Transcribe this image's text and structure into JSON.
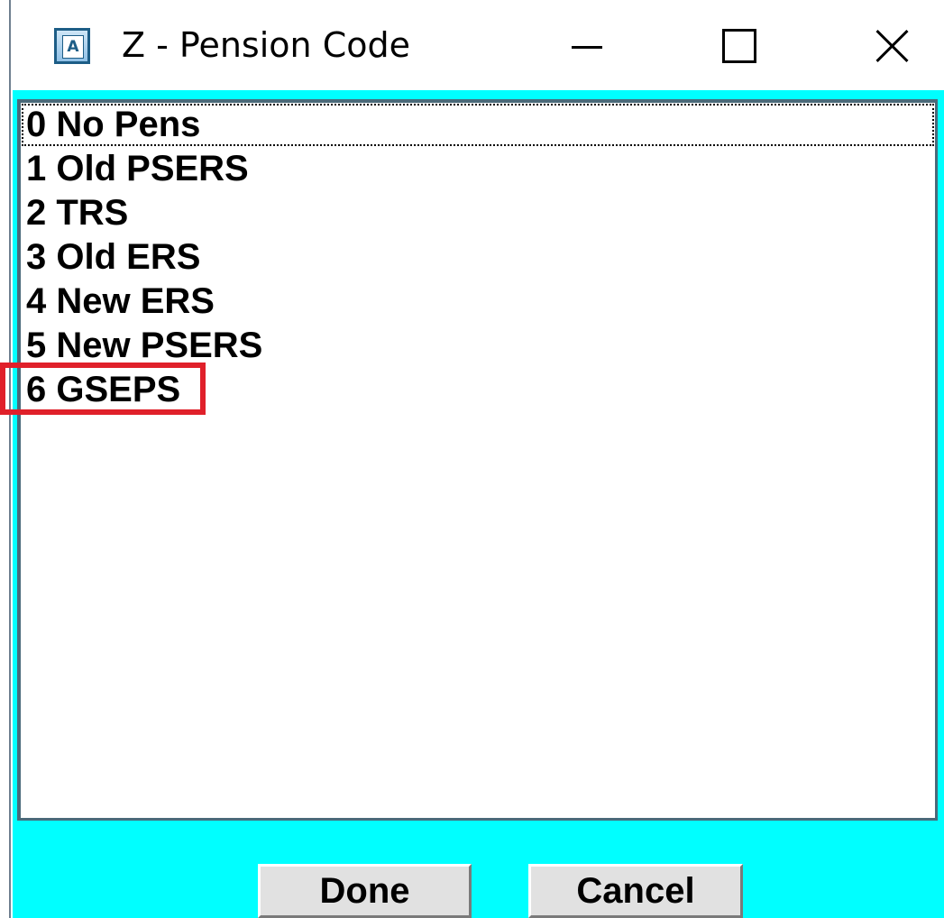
{
  "window": {
    "title": "Z - Pension Code",
    "app_icon_letter": "A",
    "caption_icons": [
      "minimize-icon",
      "maximize-icon",
      "close-icon"
    ]
  },
  "list": {
    "items": [
      "0 No Pens",
      "1 Old PSERS",
      "2 TRS",
      "3 Old ERS",
      "4 New ERS",
      "5 New PSERS",
      "6 GSEPS"
    ],
    "focused_index": 0,
    "highlighted_item": "6 GSEPS"
  },
  "buttons": {
    "done_label": "Done",
    "cancel_label": "Cancel"
  },
  "colors": {
    "client_background": "#00ffff",
    "highlight_border": "#e0202a"
  }
}
